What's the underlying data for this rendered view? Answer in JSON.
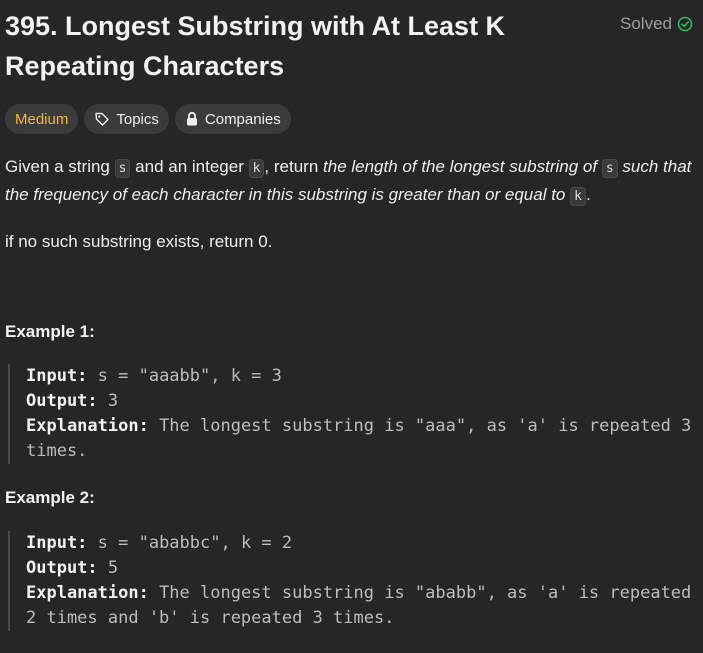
{
  "problem": {
    "title": "395. Longest Substring with At Least K Repeating Characters",
    "status": "Solved",
    "tags": {
      "difficulty": "Medium",
      "topics": "Topics",
      "companies": "Companies"
    }
  },
  "description": {
    "p1": "Given a string ",
    "s1": "s",
    "p2": " and an integer ",
    "k1": "k",
    "p3": ", return ",
    "em1": "the length of the longest substring of ",
    "s2": "s",
    "em2": " such that the frequency of each character in this substring is greater than or equal to ",
    "k2": "k",
    "p4": ".",
    "note": "if no such substring exists, return 0."
  },
  "examples": [
    {
      "title": "Example 1:",
      "input_label": "Input:",
      "input": " s = \"aaabb\", k = 3",
      "output_label": "Output:",
      "output": " 3",
      "explanation_label": "Explanation:",
      "explanation": " The longest substring is \"aaa\", as 'a' is repeated 3 times."
    },
    {
      "title": "Example 2:",
      "input_label": "Input:",
      "input": " s = \"ababbc\", k = 2",
      "output_label": "Output:",
      "output": " 5",
      "explanation_label": "Explanation:",
      "explanation": " The longest substring is \"ababb\", as 'a' is repeated 2 times and 'b' is repeated 3 times."
    }
  ],
  "colors": {
    "background": "#262626",
    "medium": "#f5b73b",
    "solved_check": "#2cbb5d"
  },
  "icons": {
    "solved": "check-circle-icon",
    "topics": "tag-icon",
    "companies": "lock-icon"
  }
}
